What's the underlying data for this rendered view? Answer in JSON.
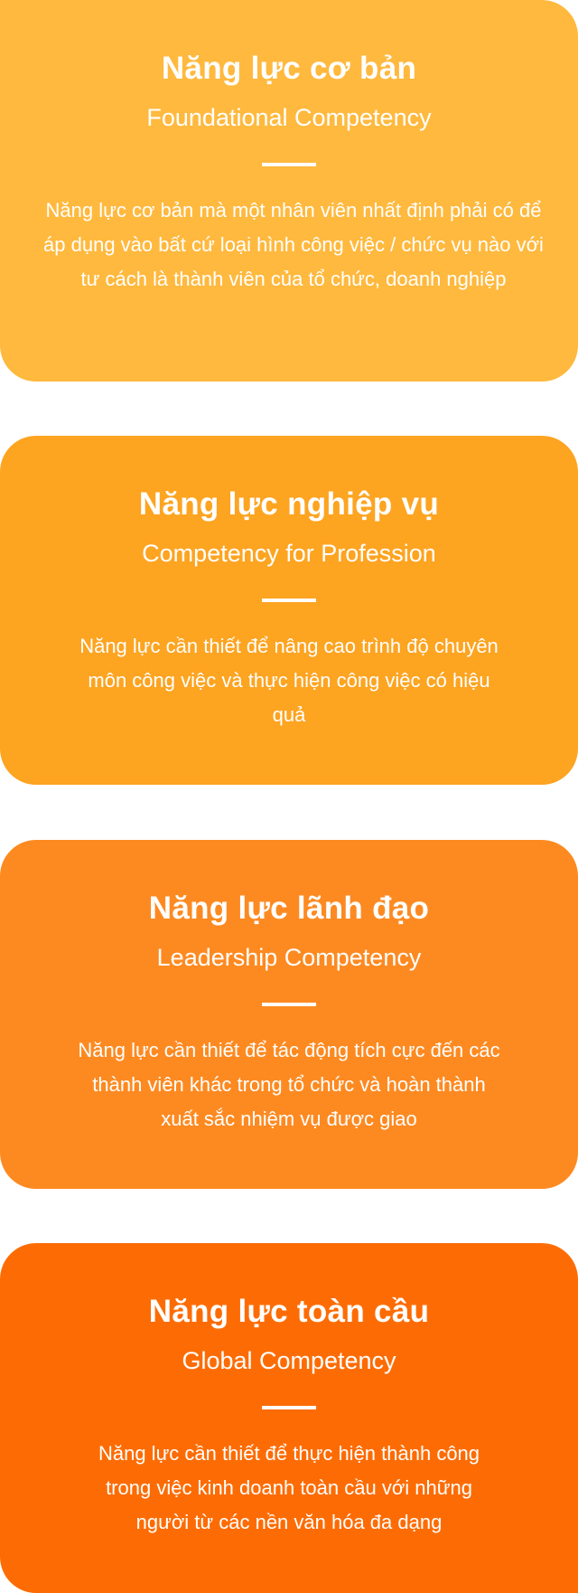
{
  "colors": {
    "card_1": "#ffb93e",
    "card_2": "#fda421",
    "card_3": "#fd8a21",
    "card_4": "#fd6c04",
    "text": "#ffffff"
  },
  "cards": [
    {
      "title": "Năng lực cơ bản",
      "subtitle": "Foundational Competency",
      "description": "Năng lực cơ bản mà một nhân viên nhất định phải có để áp dụng vào bất cứ loại hình công việc / chức vụ nào với tư cách là thành viên của tổ chức, doanh nghiệp"
    },
    {
      "title": "Năng lực nghiệp vụ",
      "subtitle": "Competency for Profession",
      "description": "Năng lực cần thiết để  nâng cao trình độ chuyên môn công việc và thực hiện công việc có hiệu  quả"
    },
    {
      "title": "Năng lực lãnh đạo",
      "subtitle": "Leadership Competency",
      "description": "Năng lực cần thiết để tác động tích cực đến các thành viên khác trong tổ chức và hoàn thành xuất sắc nhiệm vụ được giao"
    },
    {
      "title": "Năng lực toàn cầu",
      "subtitle": "Global Competency",
      "description": "Năng lực cần thiết để thực hiện thành công trong việc kinh doanh toàn cầu với những người từ các nền văn hóa đa dạng"
    }
  ]
}
